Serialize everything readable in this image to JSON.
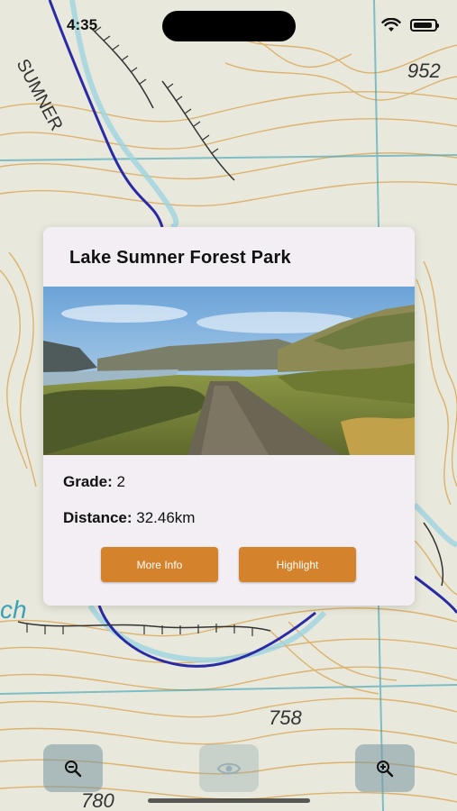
{
  "status_bar": {
    "time": "4:35"
  },
  "map": {
    "labels": [
      "SUMNER",
      "952",
      "758",
      "780",
      "ch"
    ]
  },
  "card": {
    "title": "Lake Sumner Forest Park",
    "grade_label": "Grade:",
    "grade_value": "2",
    "distance_label": "Distance:",
    "distance_value": "32.46km",
    "more_info_label": "More Info",
    "highlight_label": "Highlight",
    "accent_color": "#d4832c"
  },
  "controls": {
    "zoom_out_icon": "zoom-out-icon",
    "visibility_icon": "eye-icon",
    "zoom_in_icon": "zoom-in-icon"
  }
}
